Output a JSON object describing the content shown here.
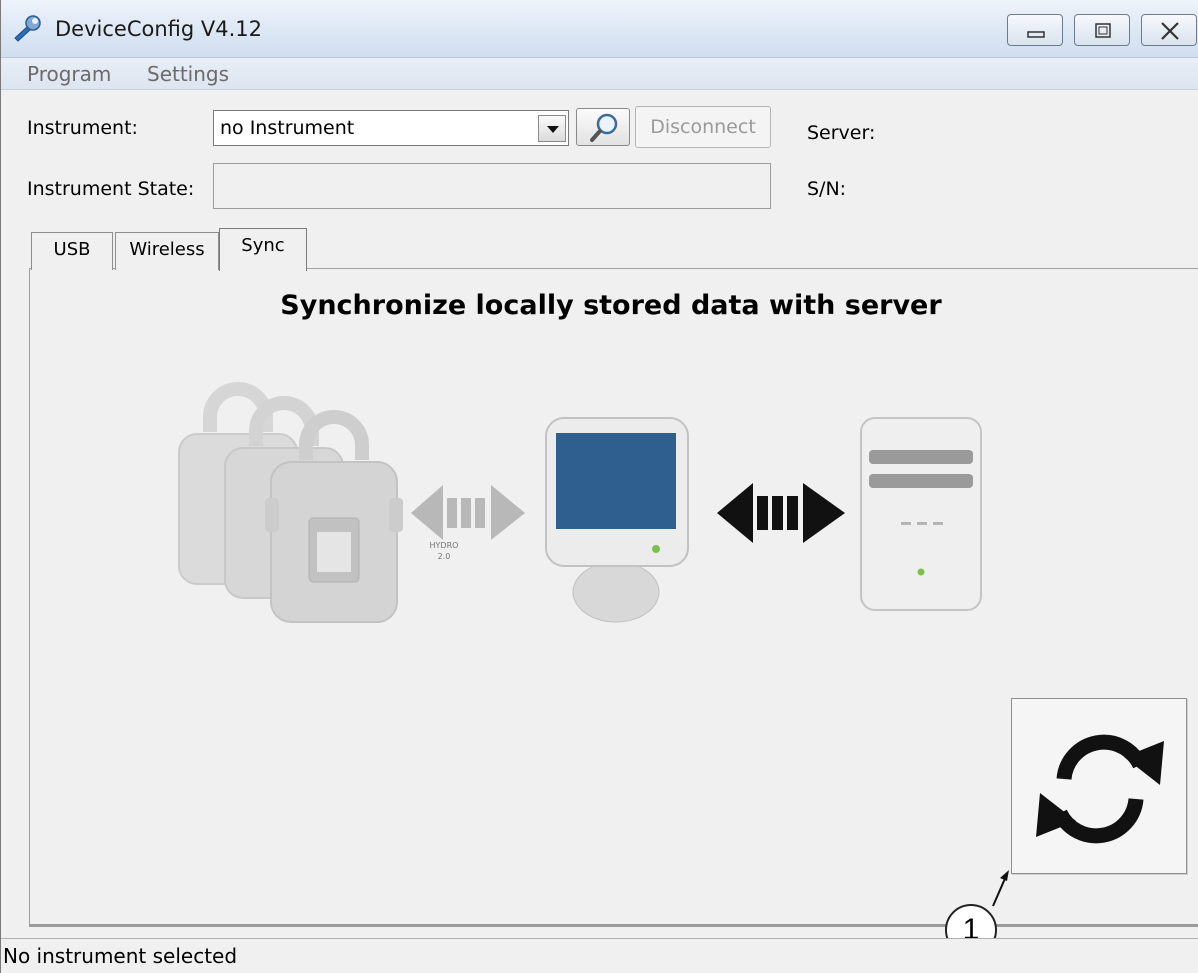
{
  "window": {
    "title": "DeviceConfig V4.12"
  },
  "menu": {
    "items": [
      {
        "label": "Program"
      },
      {
        "label": "Settings"
      }
    ]
  },
  "form": {
    "instrument_label": "Instrument:",
    "instrument_value": "no Instrument",
    "disconnect_label": "Disconnect",
    "server_label": "Server:",
    "instrument_state_label": "Instrument State:",
    "instrument_state_value": "",
    "sn_label": "S/N:"
  },
  "tabs": [
    {
      "label": "USB",
      "active": false
    },
    {
      "label": "Wireless",
      "active": false
    },
    {
      "label": "Sync",
      "active": true
    }
  ],
  "sync_panel": {
    "heading": "Synchronize locally stored data with server",
    "device_label_lines": [
      "HYDRO",
      "2.0"
    ]
  },
  "status_bar": {
    "text": "No instrument selected"
  },
  "callout": {
    "number": "1"
  },
  "colors": {
    "monitor_screen": "#2e5f8f",
    "arrow_active": "#111111",
    "arrow_inactive": "#b8b8b8",
    "led_green": "#7cc24a"
  }
}
